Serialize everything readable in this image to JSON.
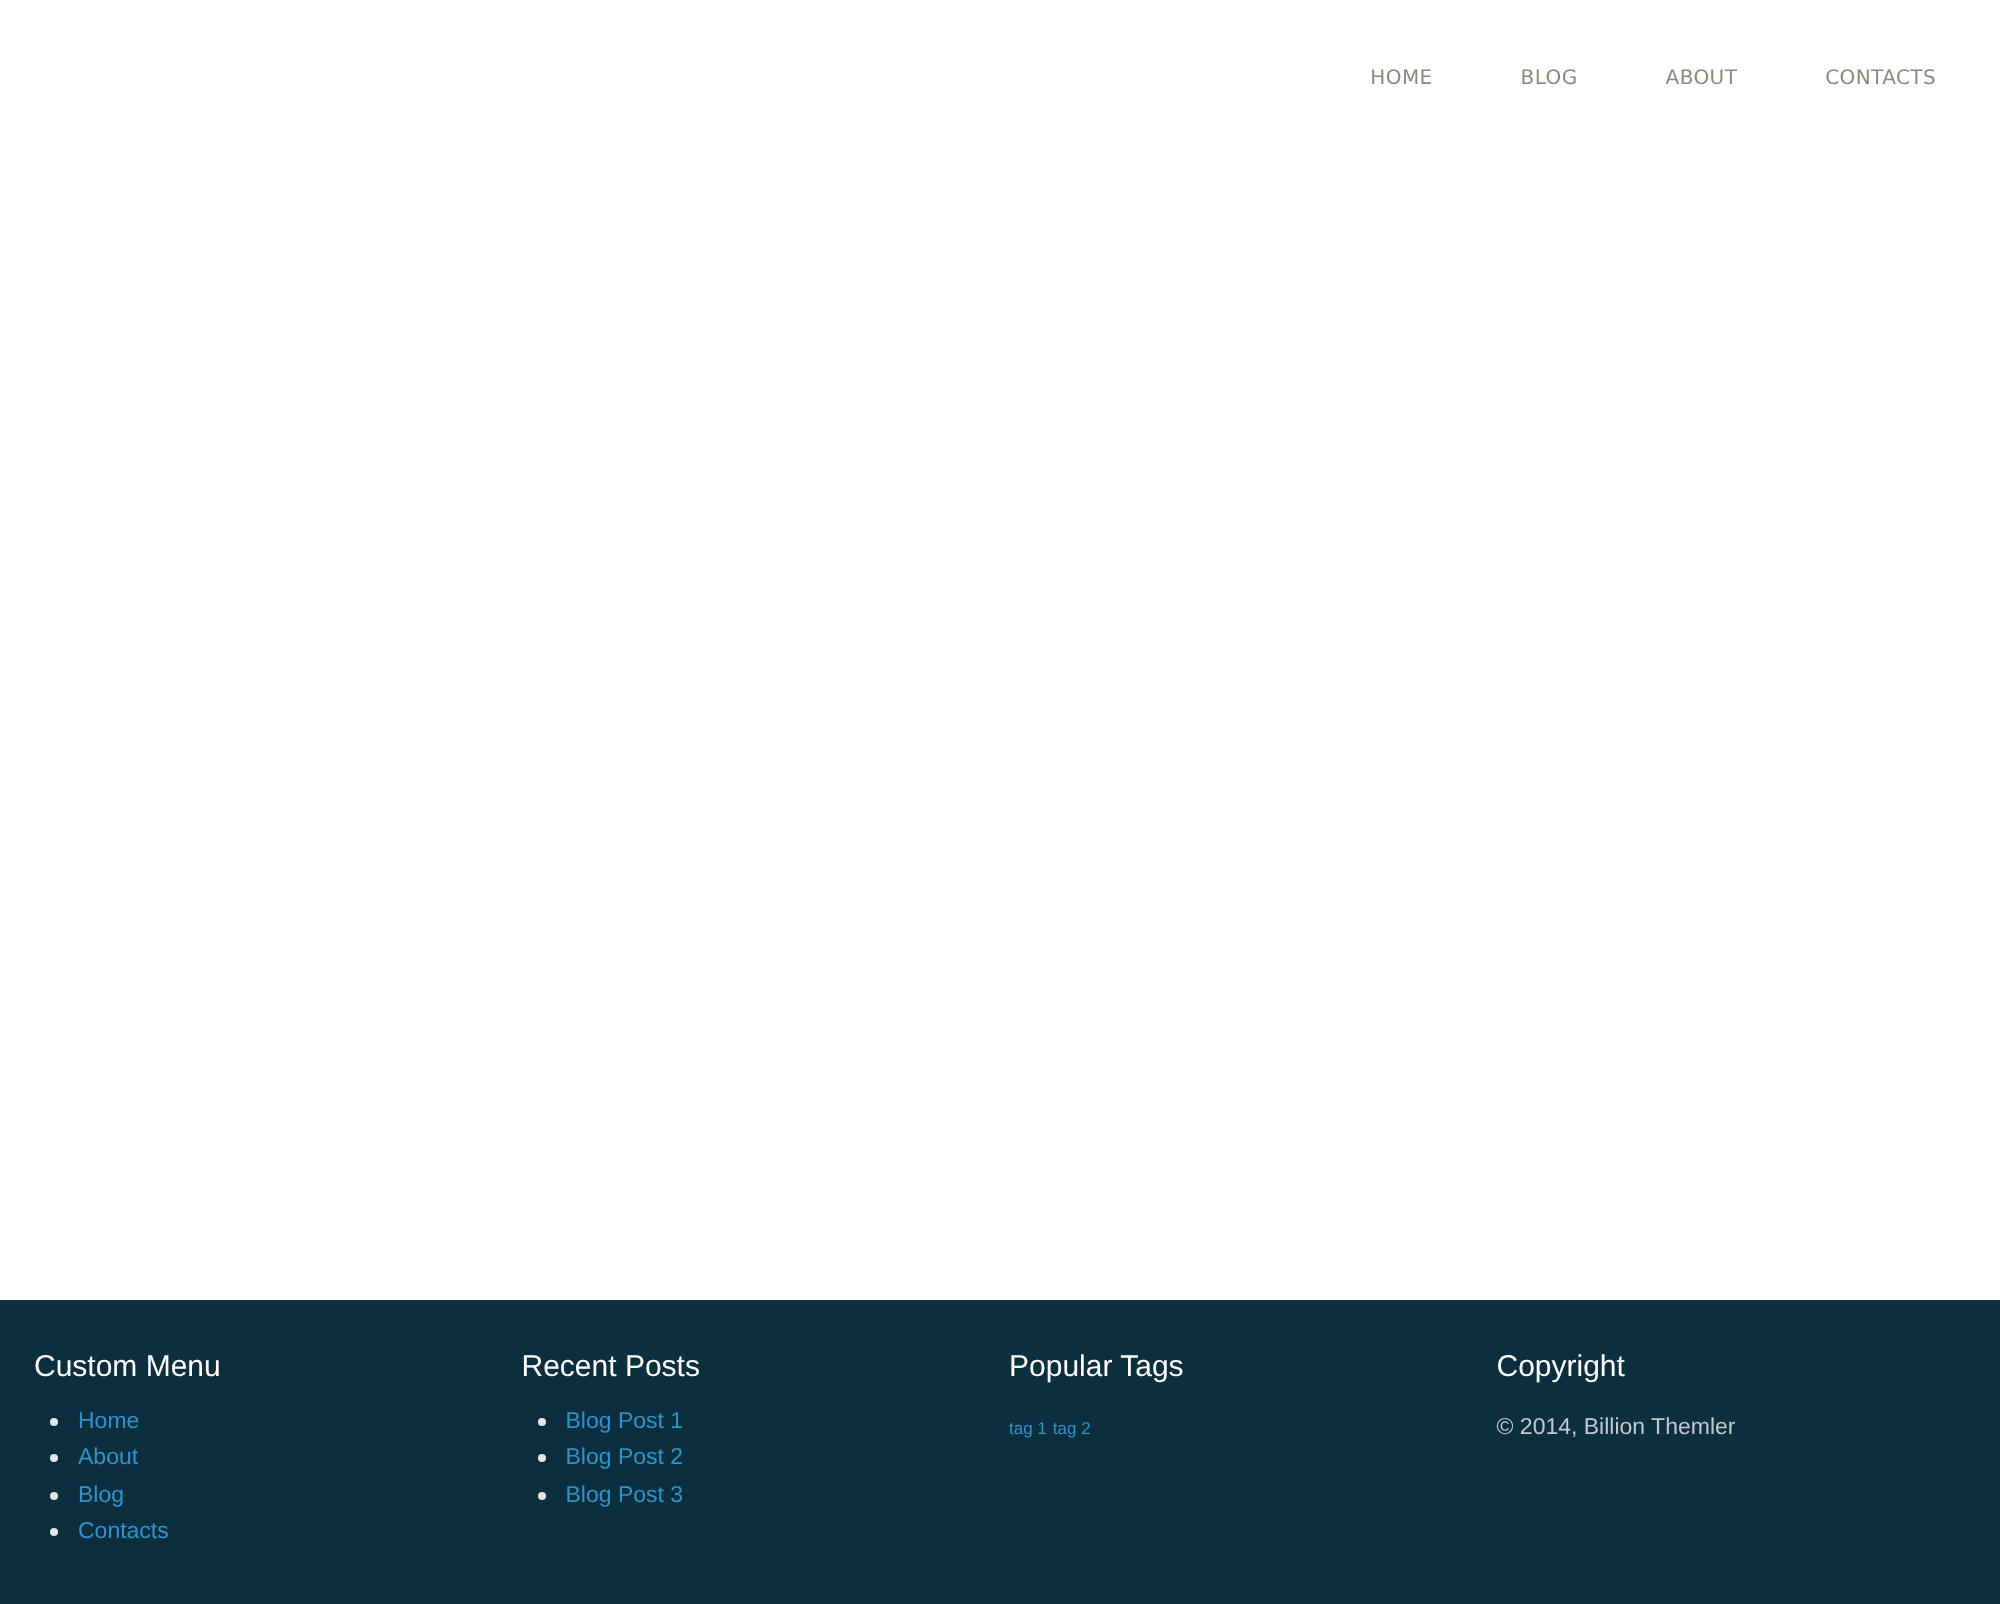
{
  "nav": [
    "HOME",
    "BLOG",
    "ABOUT",
    "CONTACTS"
  ],
  "footer": {
    "columns": [
      {
        "kind": "list",
        "title": "Custom Menu",
        "items": [
          "Home",
          "About",
          "Blog",
          "Contacts"
        ]
      },
      {
        "kind": "list",
        "title": "Recent Posts",
        "items": [
          "Blog Post 1",
          "Blog Post 2",
          "Blog Post 3"
        ]
      },
      {
        "kind": "tags",
        "title": "Popular Tags",
        "items": [
          "tag 1",
          "tag 2"
        ]
      },
      {
        "kind": "text",
        "title": "Copyright",
        "text": "© 2014, Billion Themler"
      }
    ]
  }
}
